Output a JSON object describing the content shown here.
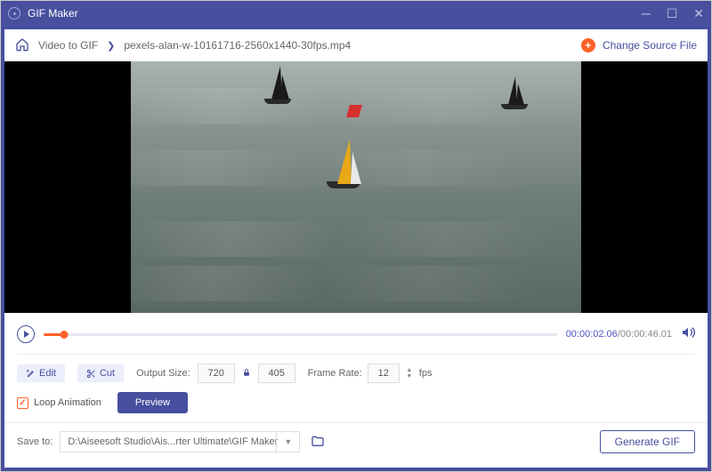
{
  "app": {
    "title": "GIF Maker"
  },
  "breadcrumb": {
    "root": "Video to GIF",
    "file": "pexels-alan-w-10161716-2560x1440-30fps.mp4"
  },
  "toolbar": {
    "change_source": "Change Source File"
  },
  "playback": {
    "current": "00:00:02.06",
    "total": "00:00:46.01"
  },
  "settings": {
    "edit": "Edit",
    "cut": "Cut",
    "output_size_label": "Output Size:",
    "width": "720",
    "height": "405",
    "frame_rate_label": "Frame Rate:",
    "frame_rate": "12",
    "fps_unit": "fps"
  },
  "options": {
    "loop_label": "Loop Animation",
    "preview": "Preview"
  },
  "footer": {
    "save_label": "Save to:",
    "save_path": "D:\\Aiseesoft Studio\\Ais...rter Ultimate\\GIF Maker",
    "generate": "Generate GIF"
  }
}
